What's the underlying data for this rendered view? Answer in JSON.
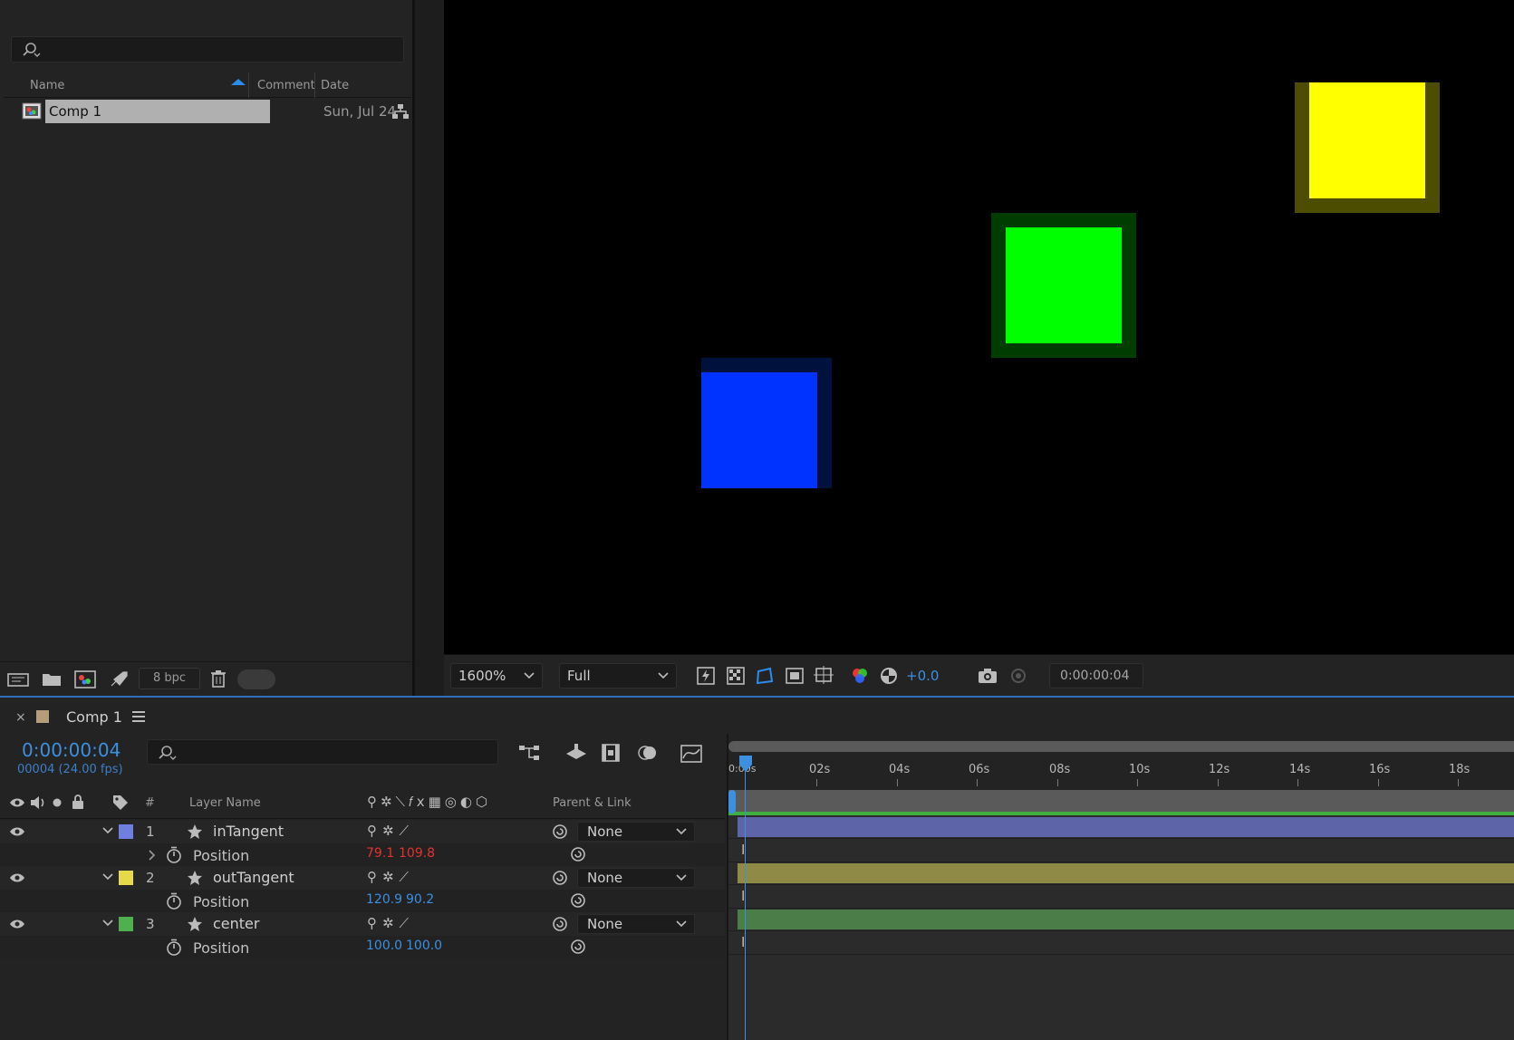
{
  "project": {
    "search_placeholder": "",
    "columns": {
      "name": "Name",
      "comment": "Comment",
      "date": "Date"
    },
    "items": [
      {
        "name": "Comp 1",
        "date": "Sun, Jul 24"
      }
    ],
    "bpc": "8 bpc"
  },
  "viewer": {
    "zoom": "1600%",
    "resolution": "Full",
    "exposure": "+0.0",
    "timecode": "0:00:00:04",
    "colors": {
      "yellow": "#ffff00",
      "green": "#00ff00",
      "blue": "#0033ff"
    }
  },
  "timeline": {
    "tab_title": "Comp 1",
    "current_time": "0:00:00:04",
    "frame_info": "00004 (24.00 fps)",
    "columns": {
      "hash": "#",
      "layer_name": "Layer Name",
      "parent": "Parent & Link"
    },
    "ruler": [
      "0:00s",
      "02s",
      "04s",
      "06s",
      "08s",
      "10s",
      "12s",
      "14s",
      "16s",
      "18s"
    ],
    "layers": [
      {
        "index": "1",
        "name": "inTangent",
        "color": "#6f7fe0",
        "parent": "None",
        "prop": "Position",
        "val_x": "79.1",
        "val_y": "109.8",
        "val_color": "#e0332f",
        "bar_color": "#5d65a8"
      },
      {
        "index": "2",
        "name": "outTangent",
        "color": "#e6d94a",
        "parent": "None",
        "prop": "Position",
        "val_x": "120.9",
        "val_y": "90.2",
        "val_color": "#3d8fe0",
        "bar_color": "#8f8a45"
      },
      {
        "index": "3",
        "name": "center",
        "color": "#4fb04f",
        "parent": "None",
        "prop": "Position",
        "val_x": "100.0",
        "val_y": "100.0",
        "val_color": "#3d8fe0",
        "bar_color": "#4a7d48"
      }
    ]
  }
}
